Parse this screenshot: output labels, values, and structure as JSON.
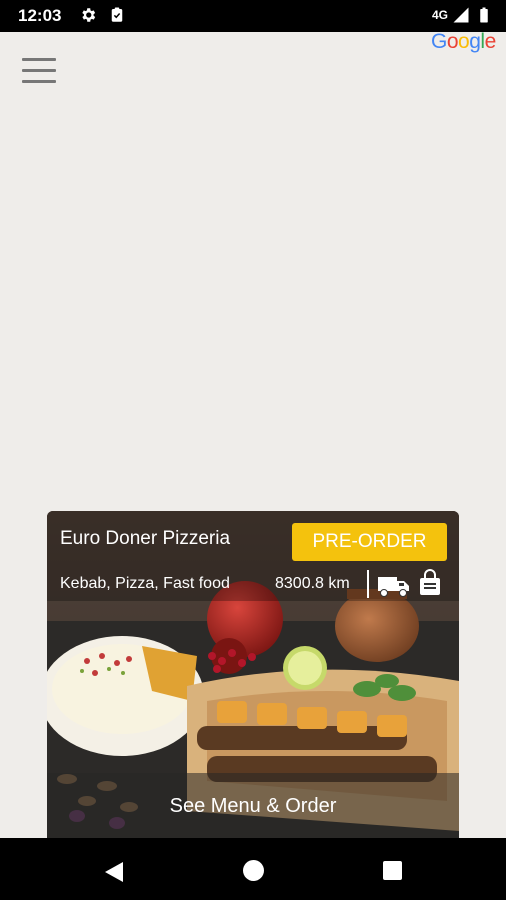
{
  "status_bar": {
    "time": "12:03",
    "network": "4G",
    "icons": [
      "settings-icon",
      "clipboard-icon",
      "signal-icon",
      "battery-icon"
    ]
  },
  "header": {
    "menu_icon": "hamburger-menu-icon",
    "logo_text": "Google",
    "logo_colors": [
      "#4285F4",
      "#EA4335",
      "#FBBC05",
      "#4285F4",
      "#34A853",
      "#EA4335"
    ]
  },
  "card": {
    "name": "Euro Doner Pizzeria",
    "preorder_label": "PRE-ORDER",
    "tags": "Kebab, Pizza, Fast food",
    "distance": "8300.8 km",
    "service_icons": [
      "delivery-truck-icon",
      "shopping-bag-icon"
    ],
    "see_menu_label": "See Menu & Order",
    "accent_color": "#f4c20d"
  },
  "nav_bar": {
    "icons": [
      "back-icon",
      "home-icon",
      "recents-icon"
    ]
  }
}
